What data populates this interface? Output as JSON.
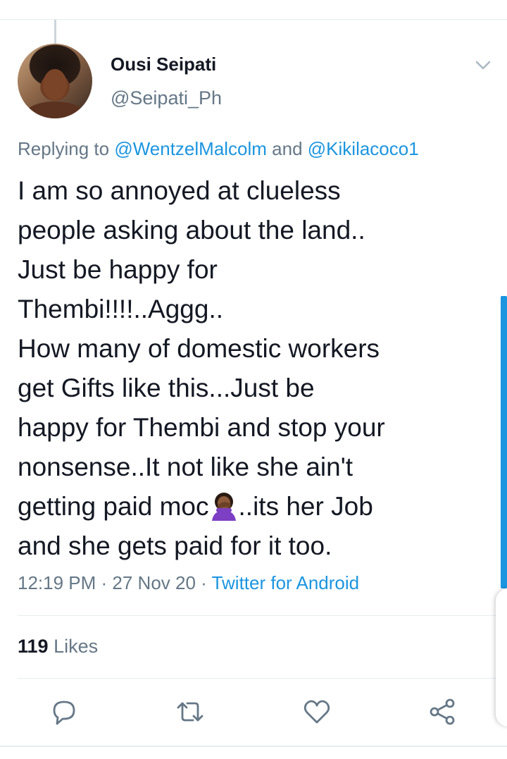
{
  "tweet": {
    "display_name": "Ousi Seipati",
    "handle": "@Seipati_Ph",
    "replying_prefix": "Replying to ",
    "reply_mentions": [
      "@WentzelMalcolm",
      "@Kikilacoco1"
    ],
    "reply_conjunction": " and ",
    "text_lines": [
      "I am so annoyed at clueless",
      "people asking about the land..",
      "Just be happy for",
      "Thembi!!!!..Aggg..",
      "How many of domestic workers",
      "get Gifts like this...Just be",
      "happy for Thembi and stop your",
      "nonsense..It not  like she ain't"
    ],
    "line9_before_emoji": "getting paid moc",
    "line9_after_emoji": "..its her Job",
    "line10": "and she gets paid for it too.",
    "emoji_name": "woman-facepalming-icon",
    "time": "12:19 PM",
    "separator": " · ",
    "date": "27 Nov 20",
    "source": "Twitter for Android",
    "likes_count": "119",
    "likes_label": " Likes"
  },
  "actions": [
    {
      "name": "reply-icon"
    },
    {
      "name": "retweet-icon"
    },
    {
      "name": "like-icon"
    },
    {
      "name": "share-icon"
    }
  ],
  "colors": {
    "link": "#1b95e0",
    "secondary_text": "#657786",
    "primary_text": "#141823",
    "divider": "#e6ecf0"
  }
}
